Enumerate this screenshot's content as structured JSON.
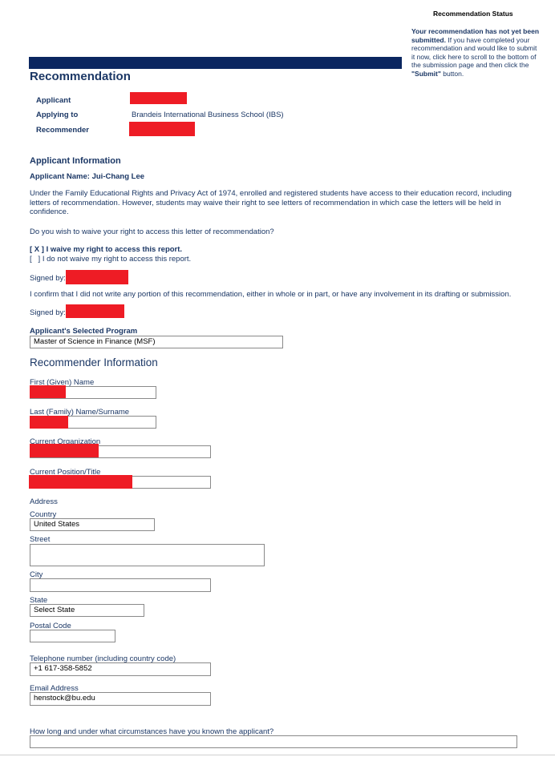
{
  "status": {
    "title": "Recommendation Status",
    "msg_bold": "Your recommendation has not yet been submitted.",
    "msg_1": " If you have completed your recommendation and would like to submit it now, ",
    "link": "click here",
    "msg_2": " to scroll to the bottom of the submission page and then click the ",
    "submit_bold": "\"Submit\"",
    "msg_3": " button."
  },
  "page_title": "Recommendation",
  "summary": {
    "applicant_label": "Applicant",
    "applying_to_label": "Applying to",
    "applying_to_value": "Brandeis International Business School (IBS)",
    "recommender_label": "Recommender"
  },
  "applicant_info": {
    "heading": "Applicant Information",
    "name_line": "Applicant Name: Jui-Chang Lee",
    "ferpa_text": "Under the Family Educational Rights and Privacy Act of 1974, enrolled and registered students have access to their education record, including letters of recommendation. However, students may waive their right to see letters of recommendation in which case the letters will be held in confidence.",
    "waive_question": "Do you wish to waive your right to access this letter of recommendation?",
    "option_waive": "[ X ] I waive my right to access this report.",
    "option_not_waive": "[   ] I do not waive my right to access this report.",
    "signed_by_1": "Signed by:",
    "confirm_text": "I confirm that I did not write any portion of this recommendation, either in whole or in part, or have any involvement in its drafting or submission.",
    "signed_by_2": "Signed by:",
    "program_label": "Applicant's Selected Program",
    "program_value": "Master of Science in Finance (MSF)"
  },
  "recommender": {
    "heading": "Recommender Information",
    "first_name_label": "First (Given) Name",
    "last_name_label": "Last (Family) Name/Surname",
    "org_label": "Current Organization",
    "position_label": "Current Position/Title",
    "address_label": "Address",
    "country_label": "Country",
    "country_value": "United States",
    "street_label": "Street",
    "city_label": "City",
    "state_label": "State",
    "state_value": "Select State",
    "postal_label": "Postal Code",
    "phone_label": "Telephone number (including country code)",
    "phone_value": "+1 617-358-5852",
    "email_label": "Email Address",
    "email_value": "henstock@bu.edu",
    "known_question": "How long and under what circumstances have you known the applicant?"
  },
  "colors": {
    "navy": "#0b2660",
    "text": "#1b3765",
    "redaction": "#ee1c25"
  }
}
